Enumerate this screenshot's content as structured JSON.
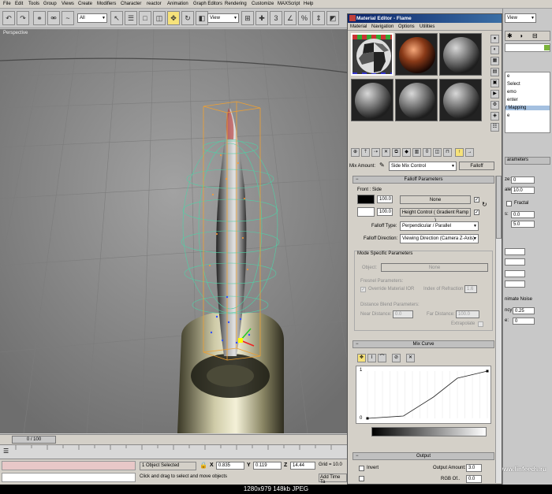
{
  "menubar": {
    "items": [
      "File",
      "Edit",
      "Tools",
      "Group",
      "Views",
      "Create",
      "Modifiers",
      "Character",
      "reactor",
      "Animation",
      "Graph Editors",
      "Rendering",
      "Customize",
      "MAXScript",
      "Help"
    ]
  },
  "toolbar": {
    "selection_filter": "All",
    "coord_system": "View",
    "right_combo": "View"
  },
  "viewport": {
    "label": "Perspective"
  },
  "timeline": {
    "frame": "0 / 100"
  },
  "status": {
    "selection": "1 Object Selected",
    "prompt": "Click and drag to select and move objects",
    "x_label": "X",
    "x_value": "0.835",
    "y_label": "Y",
    "y_value": "0.119",
    "z_label": "Z",
    "z_value": "14.44",
    "grid": "Grid = 10.0",
    "add_time_tag": "Add Time Ta"
  },
  "footer": {
    "image_info": "1280x979  148kb  JPEG"
  },
  "watermark": "www.linfeeds.ru",
  "material_editor": {
    "title": "Material Editor - Flame",
    "menu": [
      "Material",
      "Navigation",
      "Options",
      "Utilities"
    ],
    "mix_amount_label": "Mix Amount:",
    "map_name": "Side Mix Control",
    "map_type": "Falloff",
    "falloff_params": {
      "header": "Falloff Parameters",
      "front_side_label": "Front : Side",
      "front_amount": "100.0",
      "front_map": "None",
      "side_amount": "100.0",
      "side_map": "Height Control  ( Gradient Ramp )",
      "falloff_type_label": "Falloff Type:",
      "falloff_type": "Perpendicular / Parallel",
      "falloff_direction_label": "Falloff Direction:",
      "falloff_direction": "Viewing Direction (Camera Z-Axis)"
    },
    "mode_specific": {
      "header": "Mode Specific Parameters",
      "object_label": "Object:",
      "object_value": "None",
      "fresnel_label": "Fresnel Parameters:",
      "override_ior": "Override Material IOR",
      "ior_label": "Index of Refraction",
      "ior_value": "1.6",
      "distance_blend_label": "Distance Blend Parameters:",
      "near_label": "Near Distance:",
      "near_value": "0.0",
      "far_label": "Far Distance:",
      "far_value": "100.0",
      "extrapolate": "Extrapolate"
    },
    "mix_curve": {
      "header": "Mix Curve",
      "y_top": "1",
      "y_bottom": "0",
      "points": [
        [
          0.0,
          0.0
        ],
        [
          0.3,
          0.05
        ],
        [
          0.55,
          0.45
        ],
        [
          0.75,
          0.85
        ],
        [
          1.0,
          1.0
        ]
      ]
    },
    "output": {
      "header": "Output",
      "invert_label": "Invert",
      "output_amount_label": "Output Amount:",
      "output_amount": "3.0",
      "rgb_offset_label": "RGB Of..",
      "rgb_offset": "0.0"
    }
  },
  "command_panel": {
    "top_combo": "View",
    "list_items": [
      "e",
      "Select",
      "emo",
      "enter",
      "/ Mapping",
      "e"
    ],
    "params_header": "arameters",
    "fields": [
      {
        "label": "ze:",
        "value": "0"
      },
      {
        "label": "ale:",
        "value": "10.0"
      },
      {
        "label": "s:",
        "value": "0.0"
      },
      {
        "label": "",
        "value": "5.0"
      }
    ],
    "fractal_label": "Fractal",
    "animate_noise_label": "nimate Noise",
    "frequency_label": "ncy:",
    "frequency_value": "0.25",
    "phase_label": "e:",
    "phase_value": "0"
  }
}
